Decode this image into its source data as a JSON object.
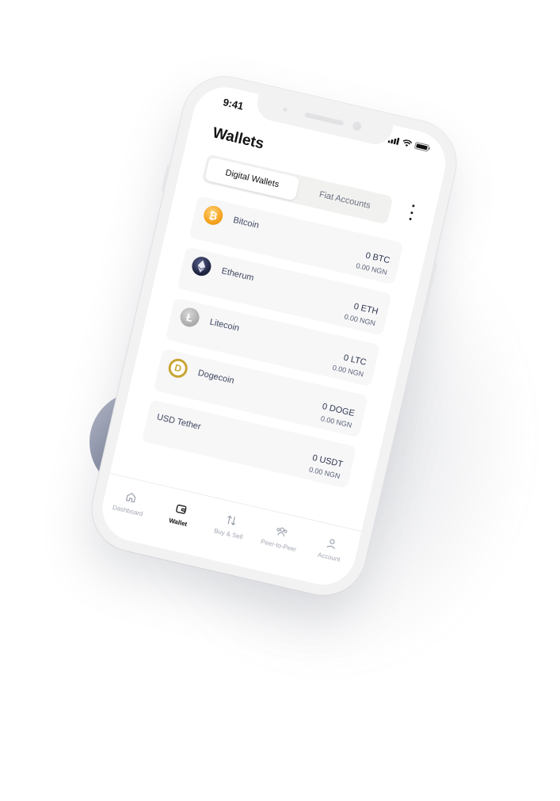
{
  "status": {
    "time": "9:41"
  },
  "page": {
    "title": "Wallets"
  },
  "tabs": [
    {
      "label": "Digital Wallets",
      "active": true
    },
    {
      "label": "Fiat Accounts",
      "active": false
    }
  ],
  "wallets": [
    {
      "name": "Bitcoin",
      "amount": "0 BTC",
      "fiat": "0.00 NGN",
      "icon": "bitcoin-icon"
    },
    {
      "name": "Etherum",
      "amount": "0 ETH",
      "fiat": "0.00 NGN",
      "icon": "ethereum-icon"
    },
    {
      "name": "Litecoin",
      "amount": "0 LTC",
      "fiat": "0.00 NGN",
      "icon": "litecoin-icon"
    },
    {
      "name": "Dogecoin",
      "amount": "0 DOGE",
      "fiat": "0.00 NGN",
      "icon": "dogecoin-icon"
    },
    {
      "name": "USD Tether",
      "amount": "0 USDT",
      "fiat": "0.00 NGN",
      "icon": ""
    }
  ],
  "bottom_nav": [
    {
      "label": "Dashboard",
      "icon": "home-icon",
      "active": false
    },
    {
      "label": "Wallet",
      "icon": "wallet-icon",
      "active": true
    },
    {
      "label": "Buy & Sell",
      "icon": "swap-icon",
      "active": false
    },
    {
      "label": "Peer-to-Peer",
      "icon": "users-icon",
      "active": false
    },
    {
      "label": "Account",
      "icon": "user-icon",
      "active": false
    }
  ],
  "colors": {
    "accent_circle": "#8a90a6",
    "bitcoin": "#f6a623",
    "ethereum": "#1f2340",
    "litecoin": "#a9a9a9",
    "dogecoin": "#c8a533"
  }
}
